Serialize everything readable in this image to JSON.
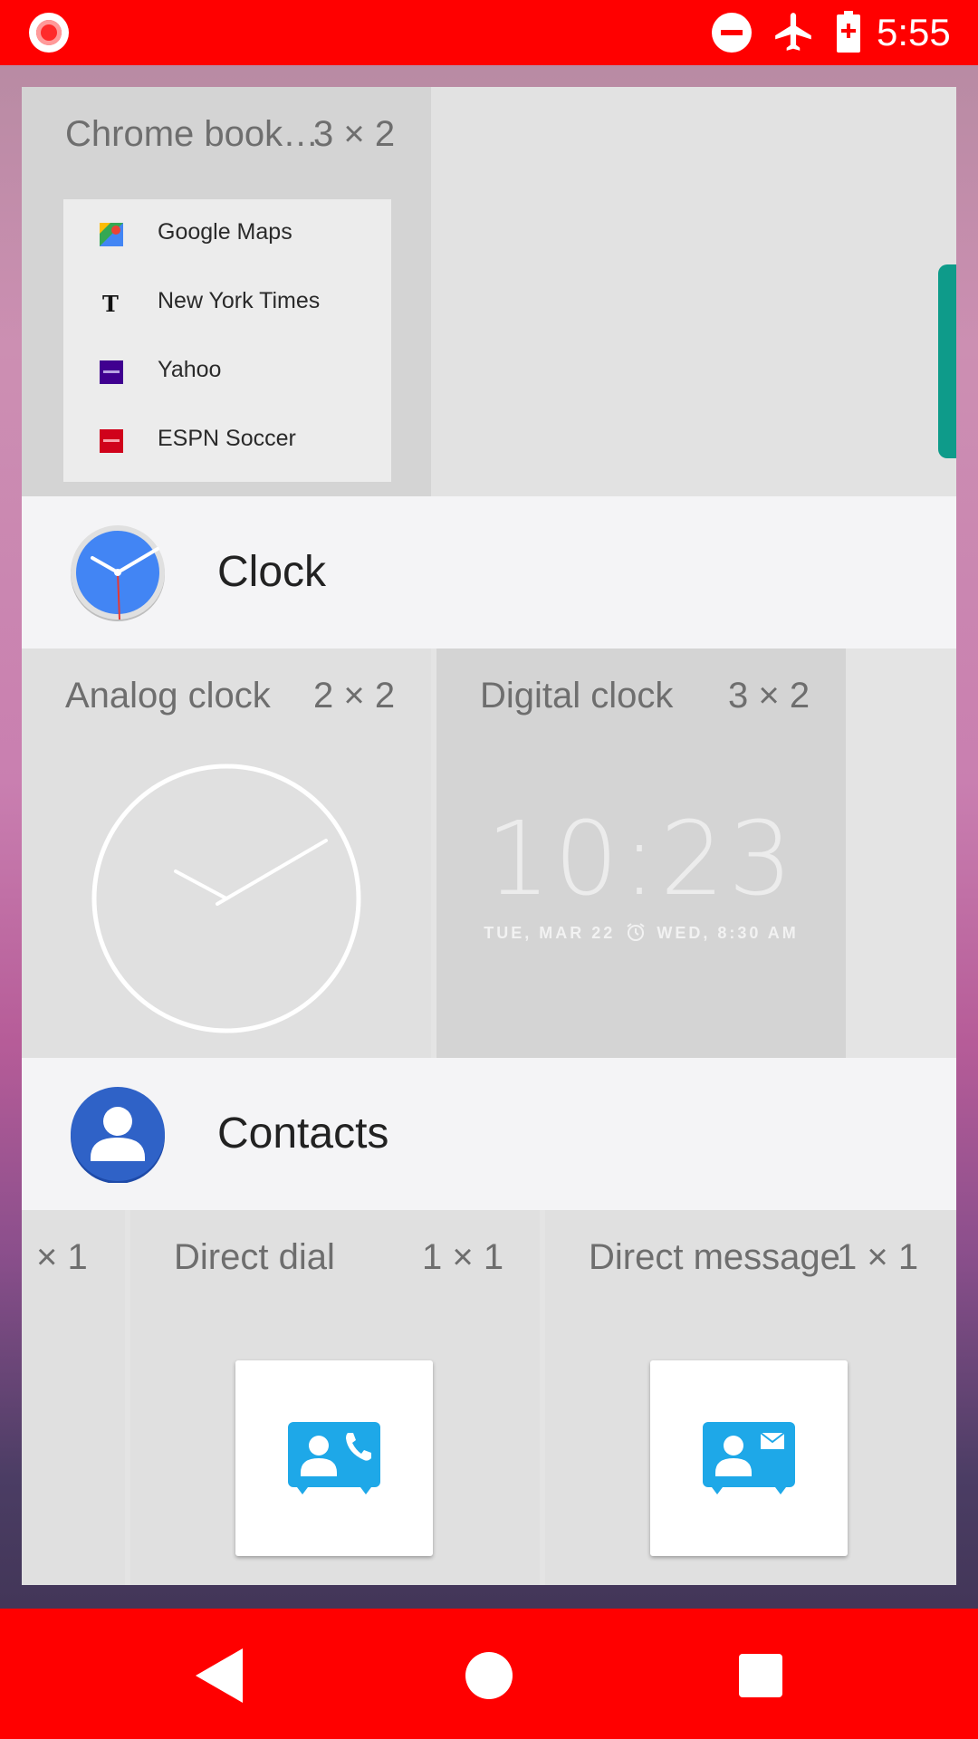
{
  "status_bar": {
    "time": "5:55",
    "icons": [
      "screen-record-icon",
      "do-not-disturb-icon",
      "airplane-mode-icon",
      "battery-charging-icon"
    ],
    "bar_color": "#ff0000"
  },
  "chrome_widget": {
    "title": "Chrome book…",
    "size": "3 × 2",
    "bookmarks": [
      {
        "label": "Google Maps",
        "icon": "google-maps-icon"
      },
      {
        "label": "New York Times",
        "icon": "nyt-icon"
      },
      {
        "label": "Yahoo",
        "icon": "yahoo-icon"
      },
      {
        "label": "ESPN Soccer",
        "icon": "espn-icon"
      }
    ]
  },
  "clock_section": {
    "app_name": "Clock",
    "widgets": [
      {
        "title": "Analog clock",
        "size": "2 × 2"
      },
      {
        "title": "Digital clock",
        "size": "3 × 2",
        "time": "10:23",
        "date": "TUE, MAR 22",
        "alarm": "WED, 8:30 AM"
      }
    ]
  },
  "contacts_section": {
    "app_name": "Contacts",
    "partial_size": "× 1",
    "widgets": [
      {
        "title": "Direct dial",
        "size": "1 × 1",
        "icon": "direct-dial-icon"
      },
      {
        "title": "Direct message",
        "size": "1 × 1",
        "icon": "direct-message-icon"
      }
    ]
  },
  "nav_bar": {
    "buttons": [
      "back-icon",
      "home-icon",
      "recents-icon"
    ]
  },
  "colors": {
    "accent_red": "#ff0000",
    "clock_blue": "#4285f4",
    "contacts_blue": "#2f62c7",
    "teal": "#0e9b8a"
  }
}
